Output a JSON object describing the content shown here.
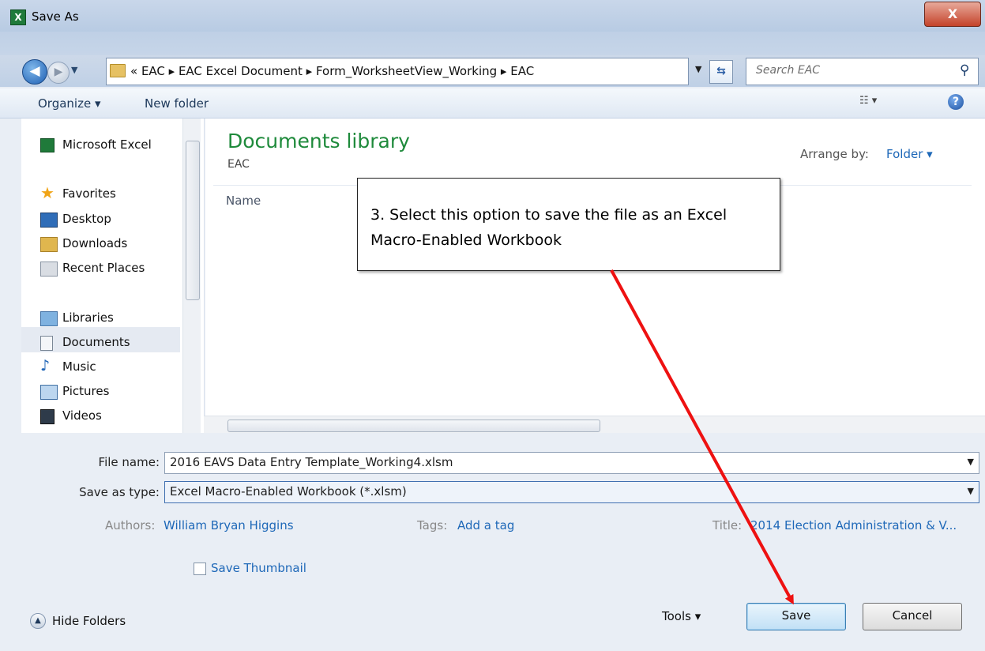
{
  "window": {
    "title": "Save As",
    "close_label": "X"
  },
  "address": {
    "crumbs": "« EAC ▸ EAC Excel Document ▸ Form_WorksheetView_Working ▸ EAC",
    "search_placeholder": "Search EAC"
  },
  "toolbar": {
    "organize_label": "Organize ▾",
    "new_folder_label": "New folder"
  },
  "nav": {
    "items": [
      {
        "label": "Microsoft Excel",
        "icon": "excel-icon"
      },
      {
        "label": "Favorites",
        "icon": "star-icon"
      },
      {
        "label": "Desktop",
        "icon": "desktop-icon"
      },
      {
        "label": "Downloads",
        "icon": "downloads-icon"
      },
      {
        "label": "Recent Places",
        "icon": "recent-places-icon"
      },
      {
        "label": "Libraries",
        "icon": "libraries-icon"
      },
      {
        "label": "Documents",
        "icon": "documents-icon"
      },
      {
        "label": "Music",
        "icon": "music-icon"
      },
      {
        "label": "Pictures",
        "icon": "pictures-icon"
      },
      {
        "label": "Videos",
        "icon": "videos-icon"
      }
    ]
  },
  "content": {
    "library_title": "Documents library",
    "library_subtitle": "EAC",
    "arrange_label": "Arrange by:",
    "arrange_value": "Folder ▾",
    "column_name": "Name"
  },
  "callout": {
    "text": "3. Select this option to save the file as an Excel Macro-Enabled Workbook"
  },
  "form": {
    "file_name_label": "File name:",
    "file_name_value": "2016 EAVS Data Entry Template_Working4.xlsm",
    "save_type_label": "Save as type:",
    "save_type_value": "Excel Macro-Enabled Workbook (*.xlsm)",
    "authors_label": "Authors:",
    "authors_value": "William Bryan Higgins",
    "tags_label": "Tags:",
    "tags_value": "Add a tag",
    "title_label": "Title:",
    "title_value": "2014 Election Administration & V...",
    "thumbnail_label": "Save Thumbnail"
  },
  "footer": {
    "hide_folders_label": "Hide Folders",
    "tools_label": "Tools ▾",
    "save_label": "Save",
    "cancel_label": "Cancel"
  },
  "colors": {
    "accent_green": "#1e8a3b",
    "link_blue": "#1e68b8",
    "arrow_red": "#ee1111"
  }
}
